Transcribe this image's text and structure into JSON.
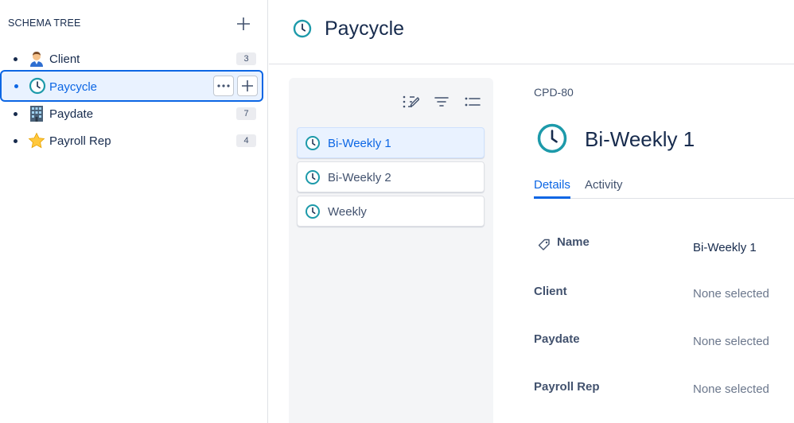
{
  "sidebar": {
    "title": "SCHEMA TREE",
    "items": [
      {
        "label": "Client",
        "icon": "person-icon",
        "count": "3"
      },
      {
        "label": "Paycycle",
        "icon": "clock-icon",
        "selected": true
      },
      {
        "label": "Paydate",
        "icon": "building-icon",
        "count": "7"
      },
      {
        "label": "Payroll Rep",
        "icon": "star-icon",
        "count": "4"
      }
    ]
  },
  "header": {
    "title": "Paycycle"
  },
  "list": {
    "items": [
      {
        "label": "Bi-Weekly 1",
        "active": true
      },
      {
        "label": "Bi-Weekly 2"
      },
      {
        "label": "Weekly"
      }
    ]
  },
  "detail": {
    "key": "CPD-80",
    "title": "Bi-Weekly 1",
    "tabs": [
      "Details",
      "Activity"
    ],
    "fields": [
      {
        "label": "Name",
        "value": "Bi-Weekly 1"
      },
      {
        "label": "Client",
        "value": "None selected"
      },
      {
        "label": "Paydate",
        "value": "None selected"
      },
      {
        "label": "Payroll Rep",
        "value": "None selected"
      }
    ]
  },
  "colors": {
    "accent": "#0c66e4",
    "clock_teal": "#1d9aaa",
    "selected_bg": "#e9f2ff"
  }
}
